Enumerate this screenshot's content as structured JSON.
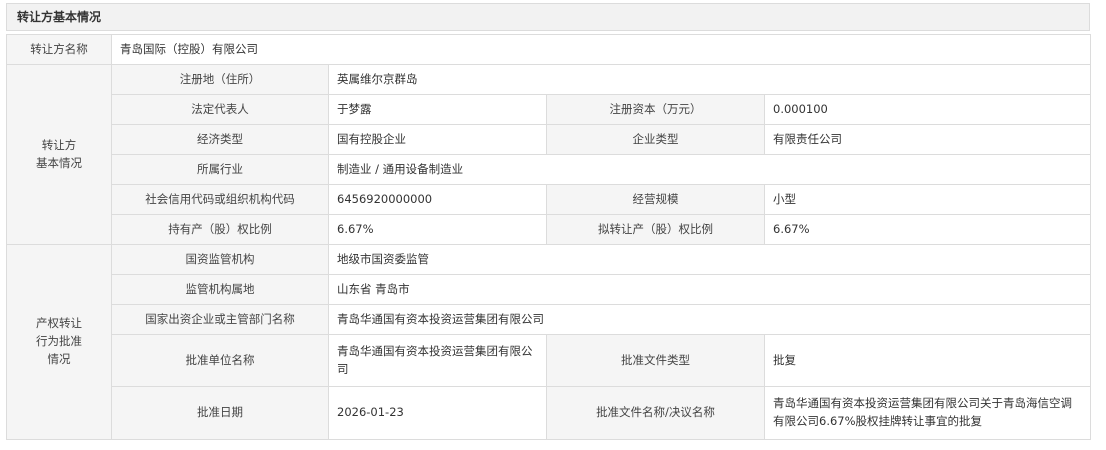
{
  "section_title": "转让方基本情况",
  "transferor_name": {
    "label": "转让方名称",
    "value": "青岛国际（控股）有限公司"
  },
  "group_basic": "转让方\n基本情况",
  "basic": {
    "reg_place": {
      "label": "注册地（住所）",
      "value": "英属维尔京群岛"
    },
    "legal_rep": {
      "label": "法定代表人",
      "value": "于梦露"
    },
    "reg_capital": {
      "label": "注册资本（万元）",
      "value": "0.000100"
    },
    "econ_type": {
      "label": "经济类型",
      "value": "国有控股企业"
    },
    "ent_type": {
      "label": "企业类型",
      "value": "有限责任公司"
    },
    "industry": {
      "label": "所属行业",
      "value": "制造业 / 通用设备制造业"
    },
    "credit_code": {
      "label": "社会信用代码或组织机构代码",
      "value": "6456920000000"
    },
    "scale": {
      "label": "经营规模",
      "value": "小型"
    },
    "hold_ratio": {
      "label": "持有产（股）权比例",
      "value": "6.67%"
    },
    "transfer_ratio": {
      "label": "拟转让产（股）权比例",
      "value": "6.67%"
    }
  },
  "group_approval": "产权转让\n行为批准\n情况",
  "approval": {
    "supervisor": {
      "label": "国资监管机构",
      "value": "地级市国资委监管"
    },
    "supervisor_loc": {
      "label": "监管机构属地",
      "value": "山东省 青岛市"
    },
    "sponsor": {
      "label": "国家出资企业或主管部门名称",
      "value": "青岛华通国有资本投资运营集团有限公司"
    },
    "approver": {
      "label": "批准单位名称",
      "value": "青岛华通国有资本投资运营集团有限公司"
    },
    "doc_type": {
      "label": "批准文件类型",
      "value": "批复"
    },
    "approve_date": {
      "label": "批准日期",
      "value": "2026-01-23"
    },
    "doc_name": {
      "label": "批准文件名称/决议名称",
      "value": "青岛华通国有资本投资运营集团有限公司关于青岛海信空调有限公司6.67%股权挂牌转让事宜的批复"
    }
  }
}
